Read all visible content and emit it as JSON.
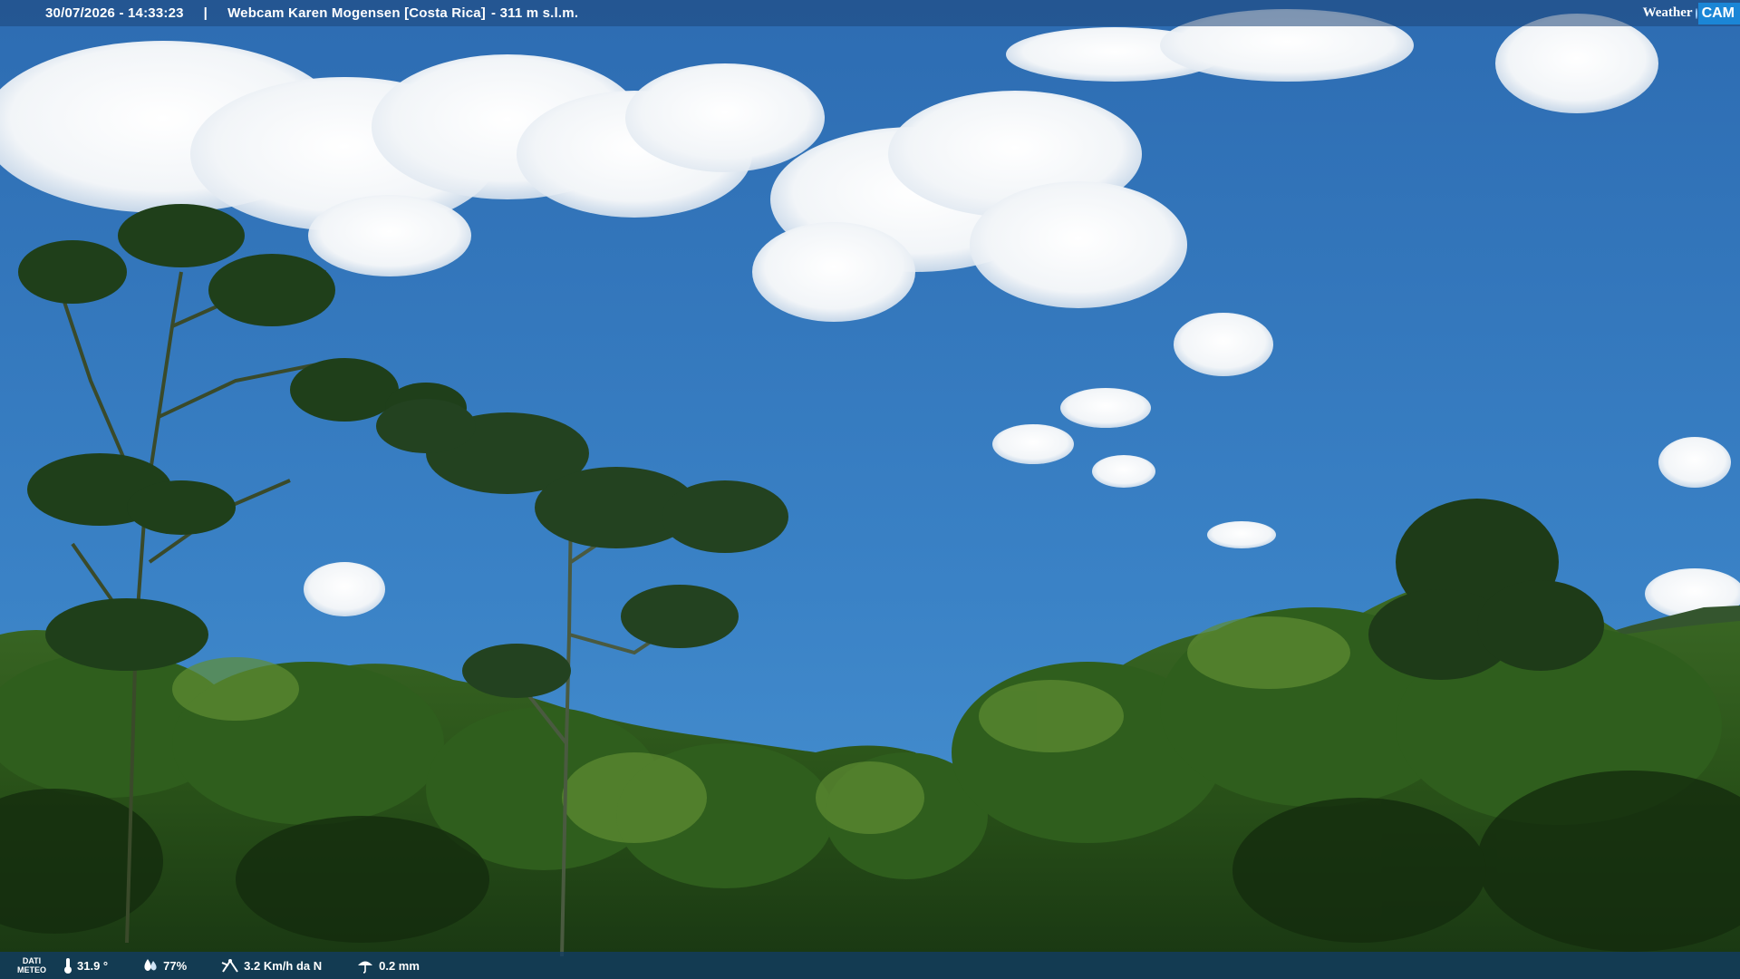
{
  "overlay": {
    "datetime": "30/07/2026 - 14:33:23",
    "separator": "|",
    "title": "Webcam Karen Mogensen [Costa Rica]",
    "elevation": "- 311 m s.l.m.",
    "logo": {
      "weather": "Weather",
      "cam": "CAM"
    }
  },
  "meteo": {
    "label_line1": "DATI",
    "label_line2": "METEO",
    "temperature": "31.9 °",
    "humidity": "77%",
    "wind": "3.2 Km/h da N",
    "rain": "0.2 mm",
    "icons": [
      "thermometer-icon",
      "humidity-icon",
      "wind-icon",
      "rain-icon"
    ]
  },
  "colors": {
    "sky_top": "#2f6fb5",
    "sky_bottom": "#3d86c9",
    "foliage_dark": "#14300f",
    "foliage_mid": "#2d5a1c",
    "foliage_light": "#6f9a3a",
    "logo_cam_bg": "#1b86d6"
  }
}
